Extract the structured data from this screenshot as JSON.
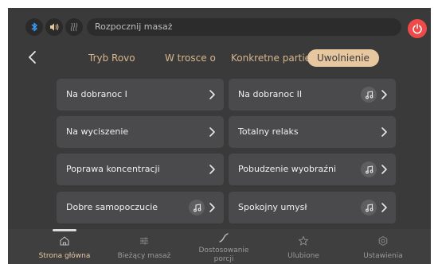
{
  "status_bar": {
    "icons": [
      "bluetooth-icon",
      "volume-icon",
      "heat-icon",
      "power-icon"
    ],
    "prompt_text": "Rozpocznij masaż"
  },
  "tabs": [
    {
      "label": "Tryb Rovo",
      "active": false
    },
    {
      "label": "W trosce o",
      "active": false
    },
    {
      "label": "Konkretne partie",
      "active": false
    },
    {
      "label": "Uwolnienie",
      "active": true
    }
  ],
  "programs": [
    {
      "label": "Na dobranoc I",
      "music": false
    },
    {
      "label": "Na dobranoc II",
      "music": true
    },
    {
      "label": "Na wyciszenie",
      "music": false
    },
    {
      "label": "Totalny relaks",
      "music": false
    },
    {
      "label": "Poprawa koncentracji",
      "music": false
    },
    {
      "label": "Pobudzenie wyobraźni",
      "music": true
    },
    {
      "label": "Dobre samopoczucie",
      "music": true
    },
    {
      "label": "Spokojny umysł",
      "music": true
    }
  ],
  "bottom_nav": [
    {
      "label": "Strona główna",
      "icon": "home-icon",
      "active": true
    },
    {
      "label": "Bieżący masaż",
      "icon": "sliders-icon",
      "active": false
    },
    {
      "label": "Dostosowanie",
      "label2": "porcji",
      "icon": "curve-icon",
      "active": false
    },
    {
      "label": "Ulubione",
      "icon": "star-icon",
      "active": false
    },
    {
      "label": "Ustawienia",
      "icon": "settings-icon",
      "active": false
    }
  ],
  "colors": {
    "background": "#3a3a3b",
    "card": "#4a4a4c",
    "accent": "#e7c79f",
    "power": "#ef4a4a",
    "bluetooth": "#3aa0ff"
  }
}
